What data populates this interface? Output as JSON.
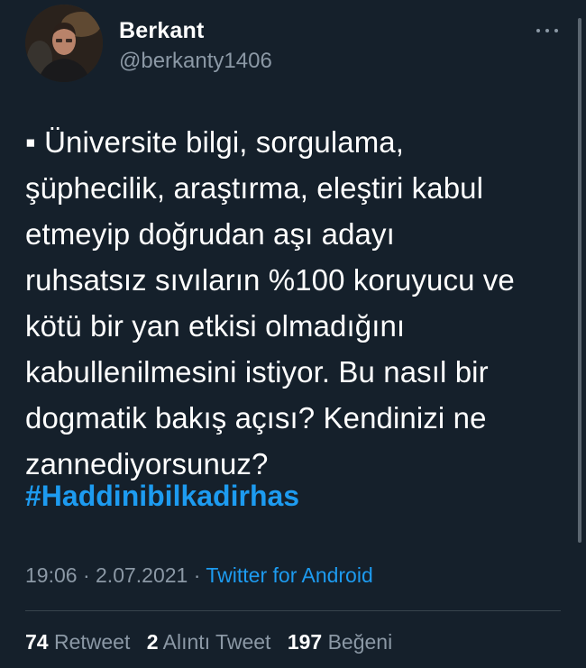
{
  "author": {
    "display_name": "Berkant",
    "handle": "@berkanty1406",
    "avatar_icon": "user-avatar-photo"
  },
  "tweet": {
    "text": "▪ Üniversite bilgi, sorgulama,\nşüphecilik, araştırma, eleştiri kabul\netmeyip doğrudan aşı adayı\nruhsatsız sıvıların %100 koruyucu ve\nkötü bir yan etkisi olmadığını\nkabullenilmesini istiyor. Bu nasıl bir\ndogmatik bakış açısı? Kendinizi ne\nzannediyorsunuz?",
    "hashtag": "#Haddinibilkadirhas",
    "time": "19:06",
    "date": "2.07.2021",
    "separator": "·",
    "source": "Twitter for Android"
  },
  "stats": {
    "retweets_count": "74",
    "retweets_label": "Retweet",
    "quotes_count": "2",
    "quotes_label": "Alıntı Tweet",
    "likes_count": "197",
    "likes_label": "Beğeni"
  },
  "colors": {
    "background": "#15202b",
    "text": "#ffffff",
    "secondary": "#8b98a5",
    "link": "#1d9bf0",
    "divider": "#38444d"
  }
}
